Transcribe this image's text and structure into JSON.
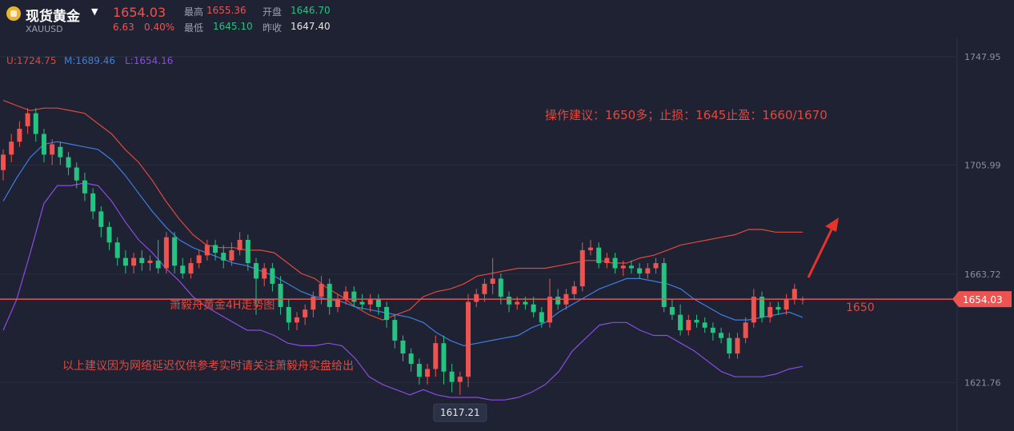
{
  "header": {
    "title": "现货黄金",
    "symbol": "XAUUSD",
    "last": "1654.03",
    "change": "6.63",
    "change_pct": "0.40%",
    "high_label": "最高",
    "high": "1655.36",
    "open_label": "开盘",
    "open": "1646.70",
    "low_label": "最低",
    "low": "1645.10",
    "prev_label": "昨收",
    "prev": "1647.40"
  },
  "indicator": {
    "upper": "U:1724.75",
    "middle": "M:1689.46",
    "lower": "L:1654.16"
  },
  "colors": {
    "up": "#ef5350",
    "down": "#26c281",
    "upper_band": "#e0493f",
    "middle_band": "#3f7fe0",
    "lower_band": "#8a4de0",
    "price_line": "#ef5350"
  },
  "chart_data": {
    "type": "candlestick",
    "y_ticks": [
      1747.95,
      1705.99,
      1663.72,
      1621.76
    ],
    "y_range": [
      1603,
      1755
    ],
    "current_price": 1654.03,
    "current_price_label": "1654.03",
    "low_marker": 1617.21,
    "low_marker_label": "1617.21",
    "level_label": "1650",
    "annotation_strategy": "操作建议：1650多；止损：1645止盈：1660/1670",
    "annotation_title": "萧毅舟黄金4H走势图",
    "annotation_disclaimer": "以上建议因为网络延迟仅供参考实时请关注萧毅舟实盘给出",
    "candles": [
      [
        1704,
        1710,
        1700,
        1712
      ],
      [
        1710,
        1715,
        1707,
        1718
      ],
      [
        1715,
        1720,
        1713,
        1723
      ],
      [
        1721,
        1726,
        1718,
        1728
      ],
      [
        1726,
        1718,
        1715,
        1728
      ],
      [
        1718,
        1710,
        1707,
        1720
      ],
      [
        1710,
        1714,
        1706,
        1716
      ],
      [
        1713,
        1709,
        1706,
        1715
      ],
      [
        1709,
        1705,
        1702,
        1711
      ],
      [
        1705,
        1700,
        1697,
        1707
      ],
      [
        1700,
        1695,
        1692,
        1703
      ],
      [
        1695,
        1688,
        1685,
        1697
      ],
      [
        1688,
        1682,
        1678,
        1690
      ],
      [
        1682,
        1676,
        1673,
        1684
      ],
      [
        1676,
        1670,
        1667,
        1678
      ],
      [
        1670,
        1667,
        1664,
        1673
      ],
      [
        1667,
        1670,
        1664,
        1672
      ],
      [
        1670,
        1668,
        1665,
        1673
      ],
      [
        1668,
        1669,
        1665,
        1671
      ],
      [
        1669,
        1666,
        1664,
        1677
      ],
      [
        1666,
        1678,
        1664,
        1680
      ],
      [
        1678,
        1667,
        1664,
        1680
      ],
      [
        1667,
        1664,
        1662,
        1670
      ],
      [
        1664,
        1668,
        1662,
        1670
      ],
      [
        1668,
        1671,
        1666,
        1673
      ],
      [
        1671,
        1675,
        1669,
        1677
      ],
      [
        1675,
        1672,
        1669,
        1677
      ],
      [
        1672,
        1669,
        1666,
        1675
      ],
      [
        1669,
        1673,
        1667,
        1676
      ],
      [
        1673,
        1677,
        1671,
        1680
      ],
      [
        1677,
        1668,
        1665,
        1679
      ],
      [
        1668,
        1662,
        1648,
        1670
      ],
      [
        1662,
        1666,
        1659,
        1668
      ],
      [
        1666,
        1660,
        1657,
        1668
      ],
      [
        1660,
        1651,
        1648,
        1663
      ],
      [
        1651,
        1645,
        1642,
        1654
      ],
      [
        1645,
        1647,
        1642,
        1649
      ],
      [
        1647,
        1650,
        1644,
        1652
      ],
      [
        1650,
        1655,
        1647,
        1657
      ],
      [
        1655,
        1660,
        1652,
        1663
      ],
      [
        1660,
        1651,
        1648,
        1662
      ],
      [
        1651,
        1654,
        1649,
        1656
      ],
      [
        1654,
        1657,
        1652,
        1659
      ],
      [
        1657,
        1653,
        1651,
        1659
      ],
      [
        1653,
        1652,
        1650,
        1656
      ],
      [
        1652,
        1654,
        1649,
        1656
      ],
      [
        1654,
        1651,
        1648,
        1656
      ],
      [
        1651,
        1646,
        1643,
        1653
      ],
      [
        1646,
        1638,
        1635,
        1648
      ],
      [
        1638,
        1633,
        1630,
        1640
      ],
      [
        1633,
        1629,
        1626,
        1635
      ],
      [
        1629,
        1624,
        1621,
        1631
      ],
      [
        1624,
        1627,
        1621,
        1629
      ],
      [
        1627,
        1637,
        1624,
        1640
      ],
      [
        1637,
        1626,
        1621,
        1640
      ],
      [
        1626,
        1622,
        1618,
        1629
      ],
      [
        1622,
        1624,
        1617,
        1626
      ],
      [
        1624,
        1653,
        1620,
        1656
      ],
      [
        1653,
        1656,
        1651,
        1658
      ],
      [
        1656,
        1660,
        1653,
        1662
      ],
      [
        1660,
        1662,
        1656,
        1670
      ],
      [
        1662,
        1655,
        1652,
        1664
      ],
      [
        1655,
        1652,
        1649,
        1657
      ],
      [
        1652,
        1653,
        1650,
        1655
      ],
      [
        1653,
        1652,
        1650,
        1655
      ],
      [
        1652,
        1649,
        1647,
        1655
      ],
      [
        1649,
        1645,
        1643,
        1651
      ],
      [
        1645,
        1655,
        1643,
        1662
      ],
      [
        1655,
        1652,
        1650,
        1658
      ],
      [
        1652,
        1656,
        1650,
        1658
      ],
      [
        1656,
        1659,
        1654,
        1661
      ],
      [
        1659,
        1673,
        1657,
        1676
      ],
      [
        1673,
        1674,
        1671,
        1677
      ],
      [
        1674,
        1668,
        1666,
        1676
      ],
      [
        1668,
        1670,
        1666,
        1672
      ],
      [
        1670,
        1666,
        1664,
        1672
      ],
      [
        1666,
        1667,
        1663,
        1669
      ],
      [
        1667,
        1666,
        1664,
        1669
      ],
      [
        1666,
        1664,
        1662,
        1668
      ],
      [
        1664,
        1666,
        1662,
        1668
      ],
      [
        1666,
        1668,
        1664,
        1670
      ],
      [
        1668,
        1651,
        1649,
        1670
      ],
      [
        1651,
        1648,
        1646,
        1654
      ],
      [
        1648,
        1642,
        1640,
        1652
      ],
      [
        1642,
        1646,
        1640,
        1648
      ],
      [
        1646,
        1645,
        1643,
        1648
      ],
      [
        1645,
        1643,
        1641,
        1647
      ],
      [
        1643,
        1641,
        1638,
        1645
      ],
      [
        1641,
        1639,
        1637,
        1643
      ],
      [
        1639,
        1633,
        1631,
        1641
      ],
      [
        1633,
        1639,
        1631,
        1641
      ],
      [
        1639,
        1645,
        1637,
        1647
      ],
      [
        1645,
        1655,
        1643,
        1658
      ],
      [
        1655,
        1647,
        1645,
        1657
      ],
      [
        1647,
        1651,
        1645,
        1653
      ],
      [
        1651,
        1650,
        1648,
        1653
      ],
      [
        1650,
        1654,
        1648,
        1656
      ],
      [
        1654,
        1658,
        1652,
        1660
      ],
      [
        1654,
        1654,
        1652,
        1655
      ]
    ],
    "upper_band": [
      1731,
      1729,
      1727,
      1728,
      1728,
      1727,
      1726,
      1722,
      1718,
      1712,
      1707,
      1700,
      1692,
      1685,
      1679,
      1675,
      1674,
      1674,
      1673,
      1673,
      1672,
      1668,
      1664,
      1662,
      1658,
      1655,
      1651,
      1648,
      1646,
      1648,
      1650,
      1655,
      1657,
      1658,
      1660,
      1663,
      1664,
      1665,
      1666,
      1666,
      1666,
      1667,
      1668,
      1669,
      1669,
      1668,
      1668,
      1670,
      1671,
      1673,
      1675,
      1676,
      1677,
      1678,
      1679,
      1681,
      1681,
      1680,
      1680,
      1680
    ],
    "middle_band": [
      1692,
      1701,
      1709,
      1714,
      1715,
      1714,
      1713,
      1712,
      1708,
      1702,
      1695,
      1688,
      1682,
      1677,
      1674,
      1672,
      1670,
      1668,
      1667,
      1665,
      1663,
      1660,
      1657,
      1655,
      1654,
      1653,
      1651,
      1650,
      1649,
      1648,
      1647,
      1645,
      1641,
      1638,
      1636,
      1637,
      1638,
      1639,
      1640,
      1643,
      1645,
      1649,
      1652,
      1655,
      1658,
      1660,
      1662,
      1662,
      1661,
      1660,
      1658,
      1654,
      1651,
      1648,
      1646,
      1646,
      1647,
      1648,
      1649,
      1647
    ],
    "lower_band": [
      1642,
      1654,
      1672,
      1691,
      1698,
      1698,
      1699,
      1698,
      1692,
      1684,
      1677,
      1672,
      1666,
      1661,
      1655,
      1651,
      1648,
      1645,
      1642,
      1642,
      1640,
      1637,
      1636,
      1636,
      1637,
      1636,
      1631,
      1624,
      1621,
      1619,
      1617,
      1619,
      1617,
      1616,
      1616,
      1616,
      1615,
      1615,
      1616,
      1618,
      1621,
      1626,
      1634,
      1639,
      1644,
      1645,
      1645,
      1642,
      1640,
      1640,
      1637,
      1634,
      1630,
      1626,
      1624,
      1624,
      1624,
      1625,
      1627,
      1628
    ]
  }
}
